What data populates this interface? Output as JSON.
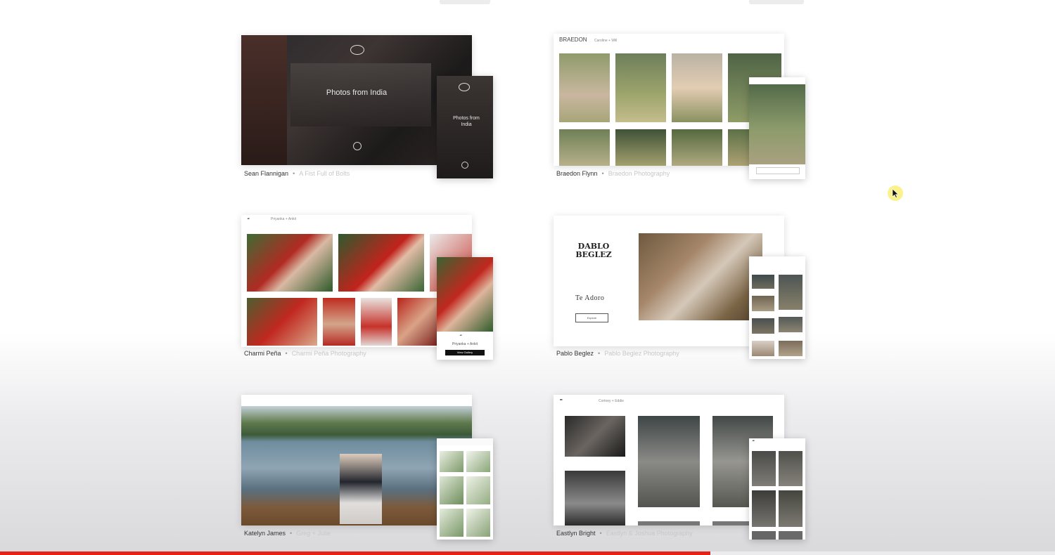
{
  "galleries": [
    {
      "photographer": "Sean Flannigan",
      "studio": "A Fist Full of Bolts",
      "cover_title": "Photos from India",
      "mobile_title": "Photos from India"
    },
    {
      "photographer": "Braedon Flynn",
      "studio": "Braedon Photography",
      "brand": "BRAEDON",
      "gallery_name": "Caroline + Will"
    },
    {
      "photographer": "Charmi Peña",
      "studio": "Charmi Peña Photography",
      "gallery_name": "Priyanka + Ankit",
      "mobile_button": "View Gallery"
    },
    {
      "photographer": "Pablo Beglez",
      "studio": "Pablo Beglez Photography",
      "brand": "DABLO BEGLEZ",
      "cover_title": "Te Adoro",
      "cover_button": "Explore"
    },
    {
      "photographer": "Katelyn James",
      "studio": "Greg + Julie"
    },
    {
      "photographer": "Eastlyn Bright",
      "studio": "Eastlyn & Joshua Photography",
      "gallery_name": "Cortney + Eddie"
    }
  ],
  "separator": "•",
  "video": {
    "progress_percent": 67.3
  },
  "colors": {
    "progress": "#e62117",
    "cursor_highlight": "#faf078"
  }
}
